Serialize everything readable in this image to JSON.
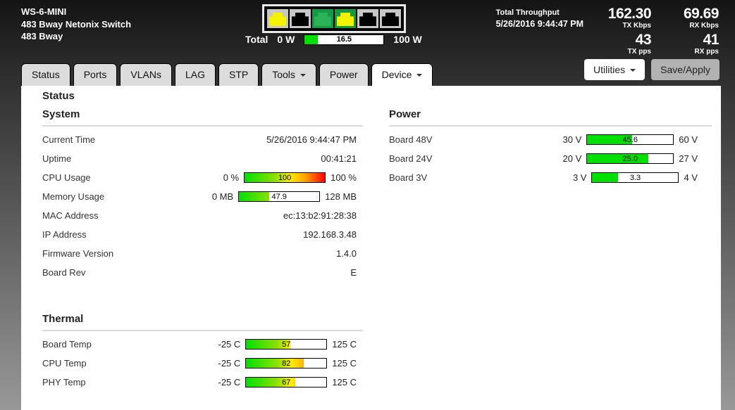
{
  "colors": {
    "gauge_green": "#00e000",
    "heat_stops": [
      "#00e000 0%",
      "#8ce000 38%",
      "#ffee00 56%",
      "#ffa000 76%",
      "#ff0000 100%"
    ],
    "port_gray": "#c7c7c7",
    "port_green": "#149a44",
    "jack_yellow": "#f5f200",
    "jack_black": "#000000",
    "jack_green": "#2cb257"
  },
  "header": {
    "device_name": "WS-6-MINI",
    "device_desc": "483 Bway Netonix Switch",
    "device_location": "483 Bway",
    "ports": [
      {
        "bg": "#c7c7c7",
        "jack": "#f5f200"
      },
      {
        "bg": "#c7c7c7",
        "jack": "#000000"
      },
      {
        "bg": "#149a44",
        "jack": "#2cb257"
      },
      {
        "bg": "#149a44",
        "jack": "#f5f200"
      },
      {
        "bg": "#c7c7c7",
        "jack": "#000000"
      },
      {
        "bg": "#c7c7c7",
        "jack": "#000000"
      }
    ],
    "total_power": {
      "label": "Total",
      "min": "0 W",
      "max": "100 W",
      "gauge": {
        "value": "16.5",
        "percent": 16.5,
        "kind": "solid"
      }
    },
    "throughput": {
      "title": "Total Throughput",
      "datetime": "5/26/2016 9:44:47 PM",
      "tx_kbps": {
        "value": "162.30",
        "unit": "TX Kbps"
      },
      "rx_kbps": {
        "value": "69.69",
        "unit": "RX Kbps"
      },
      "tx_pps": {
        "value": "43",
        "unit": "TX pps"
      },
      "rx_pps": {
        "value": "41",
        "unit": "RX pps"
      }
    }
  },
  "nav": {
    "tabs": [
      {
        "label": "Status"
      },
      {
        "label": "Ports"
      },
      {
        "label": "VLANs"
      },
      {
        "label": "LAG"
      },
      {
        "label": "STP"
      },
      {
        "label": "Tools",
        "dropdown": true
      },
      {
        "label": "Power"
      },
      {
        "label": "Device",
        "dropdown": true,
        "active": true
      }
    ],
    "utilities_label": "Utilities",
    "save_label": "Save/Apply"
  },
  "page": {
    "title": "Status",
    "system": {
      "heading": "System",
      "rows": [
        {
          "label": "Current Time",
          "value": "5/26/2016 9:44:47 PM"
        },
        {
          "label": "Uptime",
          "value": "00:41:21"
        },
        {
          "label": "CPU Usage",
          "min": "0 %",
          "max": "100 %",
          "gauge": {
            "value": "100",
            "percent": 100,
            "kind": "heat"
          }
        },
        {
          "label": "Memory Usage",
          "min": "0 MB",
          "max": "128 MB",
          "gauge": {
            "value": "47.9",
            "percent": 37.4,
            "kind": "heat"
          }
        },
        {
          "label": "MAC Address",
          "value": "ec:13:b2:91:28:38"
        },
        {
          "label": "IP Address",
          "value": "192.168.3.48"
        },
        {
          "label": "Firmware Version",
          "value": "1.4.0"
        },
        {
          "label": "Board Rev",
          "value": "E"
        }
      ]
    },
    "power": {
      "heading": "Power",
      "rows": [
        {
          "label": "Board 48V",
          "min": "30 V",
          "max": "60 V",
          "gauge": {
            "value": "45.6",
            "percent": 52,
            "kind": "solid"
          }
        },
        {
          "label": "Board 24V",
          "min": "20 V",
          "max": "27 V",
          "gauge": {
            "value": "25.0",
            "percent": 71.4,
            "kind": "solid"
          }
        },
        {
          "label": "Board 3V",
          "min": "3 V",
          "max": "4 V",
          "gauge": {
            "value": "3.3",
            "percent": 30,
            "kind": "solid"
          }
        }
      ]
    },
    "thermal": {
      "heading": "Thermal",
      "rows": [
        {
          "label": "Board Temp",
          "min": "-25 C",
          "max": "125 C",
          "gauge": {
            "value": "57",
            "percent": 54.7,
            "kind": "heat"
          }
        },
        {
          "label": "CPU Temp",
          "min": "-25 C",
          "max": "125 C",
          "gauge": {
            "value": "82",
            "percent": 71.3,
            "kind": "heat"
          }
        },
        {
          "label": "PHY Temp",
          "min": "-25 C",
          "max": "125 C",
          "gauge": {
            "value": "67",
            "percent": 61.3,
            "kind": "heat"
          }
        }
      ]
    }
  }
}
